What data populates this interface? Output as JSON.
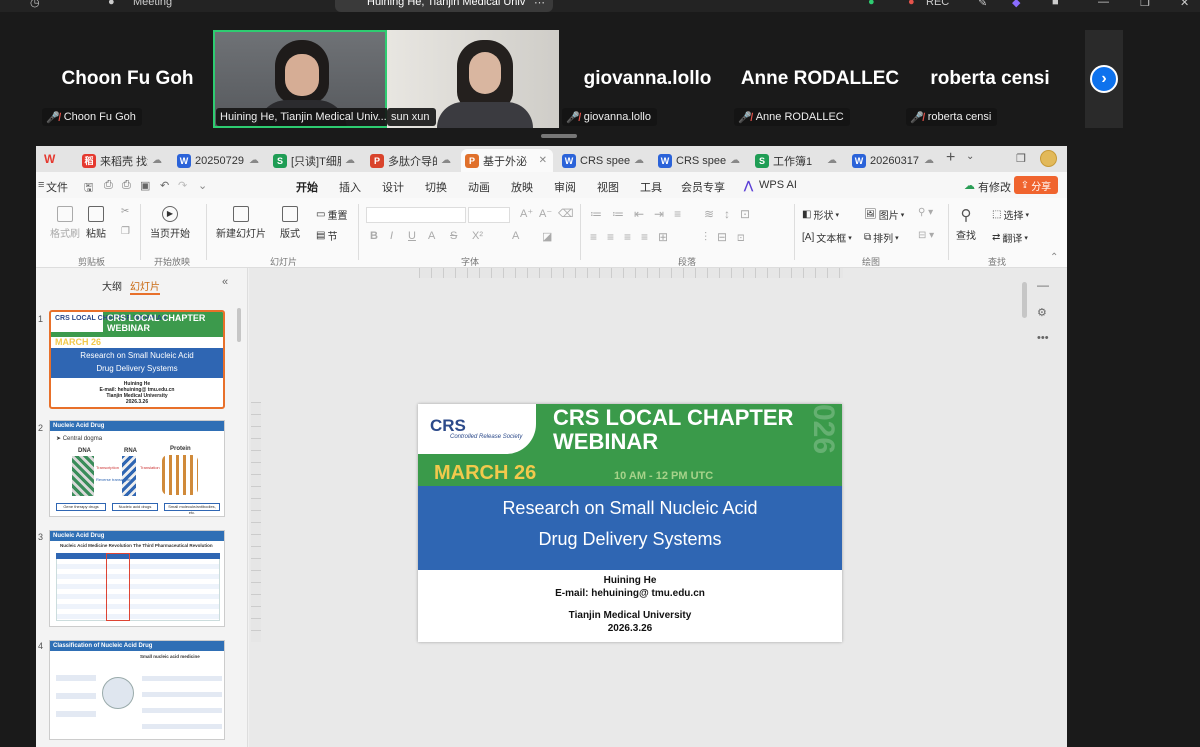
{
  "topbar": {
    "meeting_label": "Meeting",
    "active_tab_title": "Huining He, Tianjin Medical Univ",
    "rec_label": "REC"
  },
  "participants": [
    {
      "name": "Choon Fu Goh",
      "label": "Choon Fu Goh"
    },
    {
      "name": "",
      "label": "Huining He, Tianjin Medical Univ..."
    },
    {
      "name": "",
      "label": "sun xun"
    },
    {
      "name": "giovanna.lollo",
      "label": "giovanna.lollo"
    },
    {
      "name": "Anne RODALLEC",
      "label": "Anne RODALLEC"
    },
    {
      "name": "roberta censi",
      "label": "roberta censi"
    }
  ],
  "doc_tabs": [
    {
      "label": "来稻壳 找素材",
      "icon": "稻",
      "color": "#e5392f"
    },
    {
      "label": "20250729",
      "icon": "W",
      "color": "#2b63d9"
    },
    {
      "label": "[只读]T细胞",
      "icon": "S",
      "color": "#1f9d55"
    },
    {
      "label": "多肽介导的",
      "icon": "P",
      "color": "#d9432b"
    },
    {
      "label": "基于外泌",
      "icon": "P",
      "color": "#e0702b"
    },
    {
      "label": "CRS speec",
      "icon": "W",
      "color": "#2b63d9"
    },
    {
      "label": "CRS speec",
      "icon": "W",
      "color": "#2b63d9"
    },
    {
      "label": "工作簿1",
      "icon": "S",
      "color": "#1f9d55"
    },
    {
      "label": "20260317",
      "icon": "W",
      "color": "#2b63d9"
    }
  ],
  "menu": {
    "file": "文件",
    "items": [
      "开始",
      "插入",
      "设计",
      "切换",
      "动画",
      "放映",
      "审阅",
      "视图",
      "工具",
      "会员专享",
      "WPS AI"
    ],
    "has_changes": "有修改",
    "share": "分享"
  },
  "ribbon": {
    "format_painter": "格式刷",
    "paste": "粘贴",
    "play_from_start": "当页开始",
    "new_slide": "新建幻灯片",
    "layout": "版式",
    "reset": "重置",
    "section": "节",
    "shape": "形状",
    "picture": "图片",
    "textbox": "文本框",
    "arrange": "排列",
    "find": "查找",
    "select": "选择",
    "translate": "翻译",
    "groups": {
      "clipboard": "剪贴板",
      "slideshow": "开始放映",
      "slides": "幻灯片",
      "font": "字体",
      "paragraph": "段落",
      "drawing": "绘图",
      "find": "查找"
    }
  },
  "panel": {
    "outline_tab": "大纲",
    "slides_tab": "幻灯片"
  },
  "thumbnails": [
    {
      "num": "1",
      "title": "CRS LOCAL CHAPTER WEBINAR",
      "date": "MARCH 26",
      "time": "10 AM - 12 PM UTC",
      "sub1": "Research on Small Nucleic Acid",
      "sub2": "Drug Delivery Systems",
      "lines": [
        "Huining He",
        "E-mail: hehuining@ tmu.edu.cn",
        "Tianjin Medical University",
        "2026.3.26"
      ]
    },
    {
      "num": "2",
      "header": "Nucleic Acid Drug",
      "bullet": "Central dogma",
      "labels": [
        "DNA",
        "RNA",
        "Protein"
      ],
      "mid": [
        "Transcription",
        "Translation",
        "Reverse transcription"
      ],
      "boxes": [
        "Gene therapy drugs",
        "Nucleic acid drugs",
        "Small molecule/antibodies, etc."
      ]
    },
    {
      "num": "3",
      "header": "Nucleic Acid Drug",
      "sub": "Nucleic Acid Medicine Revolution The Third Pharmaceutical Revolution"
    },
    {
      "num": "4",
      "header": "Classification of Nucleic Acid Drug",
      "sub": "Small nucleic acid medicine"
    }
  ],
  "slide": {
    "title_line1": "CRS LOCAL CHAPTER",
    "title_line2": "WEBINAR",
    "logo_main": "CRS",
    "logo_sub": "Controlled Release Society",
    "date": "MARCH 26",
    "time": "10 AM - 12 PM UTC",
    "watermark": "026",
    "subtitle_line1": "Research on Small Nucleic Acid",
    "subtitle_line2": "Drug Delivery Systems",
    "author": "Huining He",
    "email": "E-mail: hehuining@ tmu.edu.cn",
    "affiliation": "Tianjin Medical University",
    "slide_date": "2026.3.26"
  },
  "colors": {
    "slide_green": "#3a9a4a",
    "slide_blue": "#2f66b3",
    "accent_orange": "#e8702a",
    "zoom_blue": "#0e72ed"
  }
}
